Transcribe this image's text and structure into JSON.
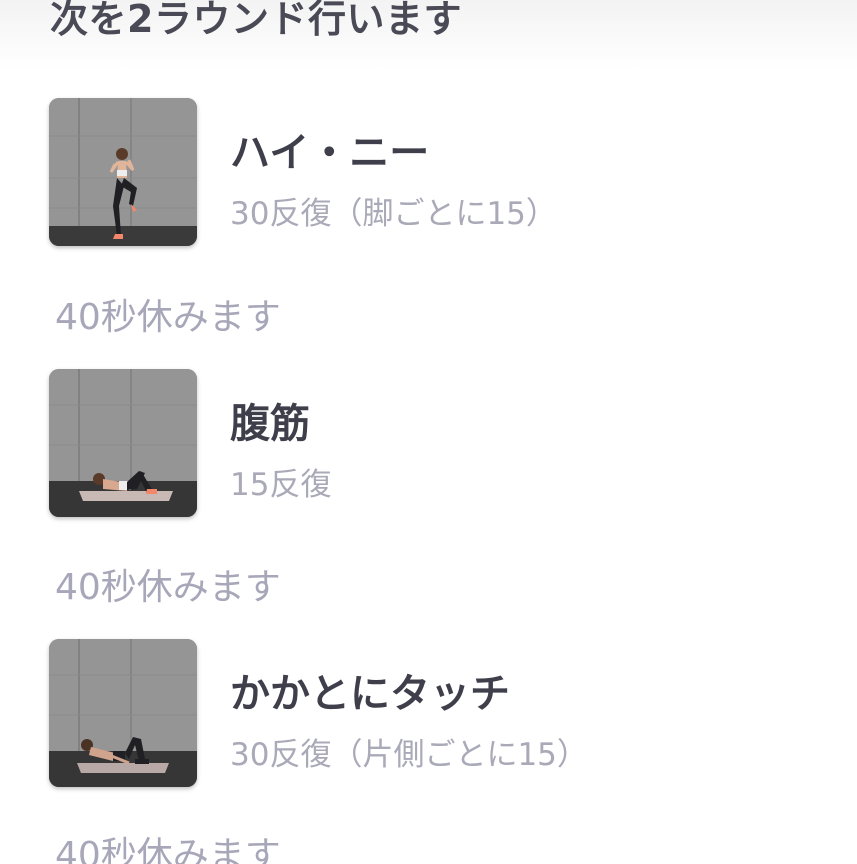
{
  "header": {
    "title": "次を2ラウンド行います"
  },
  "exercises": [
    {
      "name": "ハイ・ニー",
      "reps": "30反復（脚ごとに15）",
      "image": "high-knees-exercise-photo"
    },
    {
      "name": "腹筋",
      "reps": "15反復",
      "image": "sit-ups-exercise-photo"
    },
    {
      "name": "かかとにタッチ",
      "reps": "30反復（片側ごとに15）",
      "image": "heel-touch-exercise-photo"
    }
  ],
  "rests": [
    {
      "label": "40秒休みます"
    },
    {
      "label": "40秒休みます"
    },
    {
      "label": "40秒休みます"
    }
  ],
  "colors": {
    "title": "#4a4a57",
    "exercise_name": "#3f3f4c",
    "secondary_text": "#a9a9b8",
    "background": "#ffffff"
  }
}
